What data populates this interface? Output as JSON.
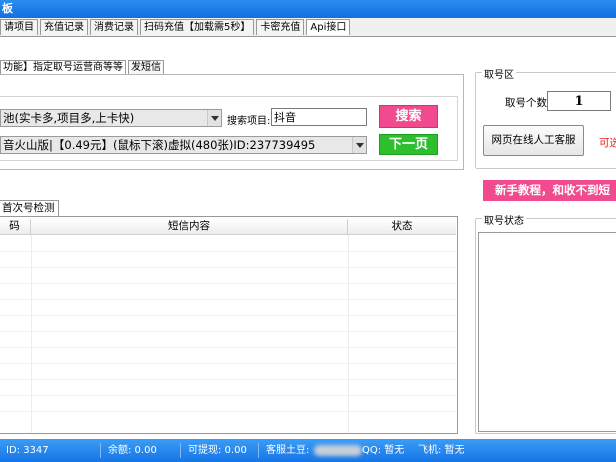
{
  "window": {
    "title": "板"
  },
  "top_tabs": [
    {
      "label": "请项目",
      "active": false
    },
    {
      "label": "充值记录",
      "active": false
    },
    {
      "label": "消费记录",
      "active": false
    },
    {
      "label": "扫码充值【加载需5秒】",
      "active": false
    },
    {
      "label": "卡密充值",
      "active": false
    },
    {
      "label": "Api接口",
      "active": true
    }
  ],
  "sub_tabs": [
    {
      "label": "功能】指定取号运营商等等",
      "active": true
    },
    {
      "label": "发短信",
      "active": false
    }
  ],
  "search": {
    "pool_select": "池(实卡多,项目多,上卡快)",
    "label": "搜索项目:",
    "value": "抖音",
    "search_button": "搜索",
    "project_select": "音火山版|【0.49元】(鼠标下滚)虚拟(480张)ID:237739495",
    "next_button": "下一页"
  },
  "take_number": {
    "group_title": "取号区",
    "count_label": "取号个数",
    "count_value": "1",
    "service_button": "网页在线人工客服",
    "side_text": "可选"
  },
  "tutorial_banner": "新手教程，和收不到短",
  "detection_tab": "首次号检测",
  "table": {
    "columns": [
      "码",
      "短信内容",
      "状态"
    ]
  },
  "status_group_title": "取号状态",
  "status_bar": {
    "id": "ID: 3347",
    "balance": "余额: 0.00",
    "withdrawable": "可提现: 0.00",
    "service": "客服土豆:",
    "qq": "QQ: 暂无",
    "plane": "飞机: 暂无"
  },
  "colors": {
    "accent_blue": "#1575e6",
    "pink": "#f24a8f",
    "green": "#2dbf2d",
    "warn_red": "#e02020"
  }
}
